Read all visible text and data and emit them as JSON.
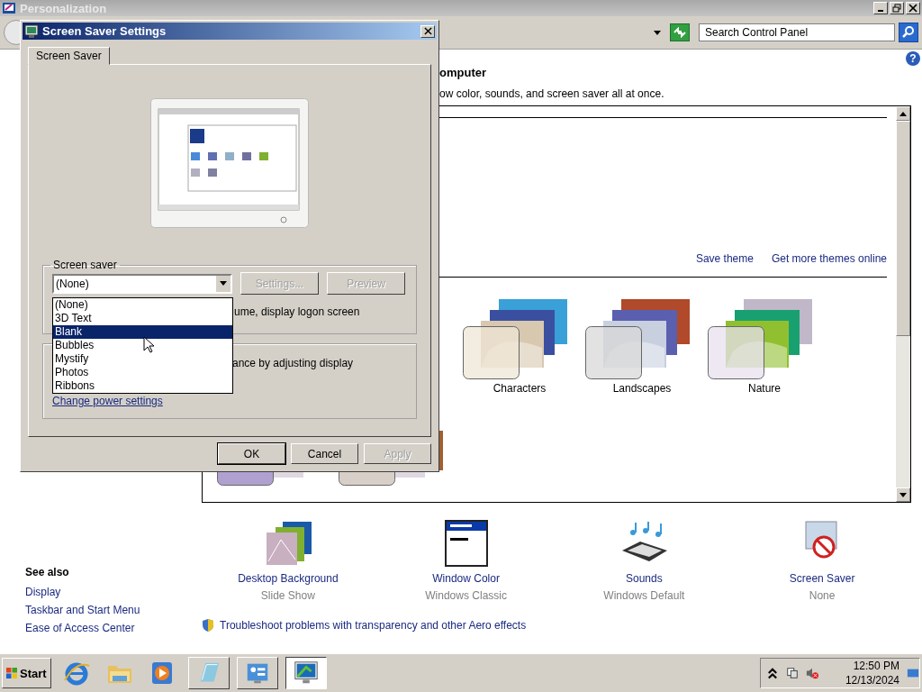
{
  "window": {
    "title": "Personalization"
  },
  "address_bar": {
    "search": {
      "placeholder": "Search Control Panel"
    }
  },
  "header": {
    "title": "omputer",
    "description": "ow color, sounds, and screen saver all at once.",
    "help": "?"
  },
  "themes": {
    "links": [
      "Save theme",
      "Get more themes online"
    ],
    "items": [
      {
        "name": "Characters"
      },
      {
        "name": "Landscapes"
      },
      {
        "name": "Nature"
      }
    ]
  },
  "settings": [
    {
      "label": "Desktop Background",
      "value": "Slide Show",
      "kind": "background"
    },
    {
      "label": "Window Color",
      "value": "Windows Classic",
      "kind": "color"
    },
    {
      "label": "Sounds",
      "value": "Windows Default",
      "kind": "sounds"
    },
    {
      "label": "Screen Saver",
      "value": "None",
      "kind": "saver"
    }
  ],
  "see_also": {
    "title": "See also",
    "links": [
      "Display",
      "Taskbar and Start Menu",
      "Ease of Access Center"
    ]
  },
  "troubleshoot_link": "Troubleshoot problems with transparency and other Aero effects",
  "dialog": {
    "title": "Screen Saver Settings",
    "tabs": [
      {
        "label": "Screen Saver",
        "selected": true
      }
    ],
    "screen_saver_group": {
      "title": "Screen saver",
      "combo_value": "(None)",
      "buttons": [
        {
          "label": "Settings...",
          "disabled": true
        },
        {
          "label": "Preview",
          "disabled": true
        }
      ],
      "resume_text": "ume, display logon screen",
      "options": [
        {
          "label": "(None)",
          "selected": false
        },
        {
          "label": "3D Text",
          "selected": false
        },
        {
          "label": "Blank",
          "selected": true
        },
        {
          "label": "Bubbles",
          "selected": false
        },
        {
          "label": "Mystify",
          "selected": false
        },
        {
          "label": "Photos",
          "selected": false
        },
        {
          "label": "Ribbons",
          "selected": false
        }
      ]
    },
    "power_group": {
      "text": "ance by adjusting display",
      "link": "Change power settings"
    },
    "buttons": [
      {
        "label": "OK",
        "disabled": false,
        "default": true
      },
      {
        "label": "Cancel",
        "disabled": false,
        "default": false
      },
      {
        "label": "Apply",
        "disabled": true,
        "default": false
      }
    ]
  },
  "taskbar": {
    "start": "Start",
    "clock": {
      "time": "12:50 PM",
      "date": "12/13/2024"
    }
  }
}
